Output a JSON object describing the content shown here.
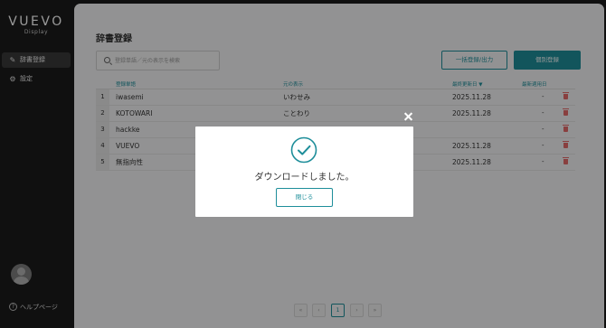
{
  "app": {
    "logo": "VUEVO",
    "logo_sub": "Display"
  },
  "sidebar": {
    "items": [
      {
        "label": "辞書登録",
        "icon": "edit-icon"
      },
      {
        "label": "設定",
        "icon": "gear-icon"
      }
    ],
    "help_label": "ヘルプページ"
  },
  "page": {
    "title": "辞書登録",
    "search_placeholder": "登録単語／元の表示を検索",
    "bulk_button": "一括登録/出力",
    "single_button": "個別登録"
  },
  "table": {
    "columns": [
      "登録単語",
      "元の表示",
      "最終更新日 ▼",
      "最新適用日"
    ],
    "rows": [
      {
        "no": "1",
        "word": "iwasemi",
        "original": "いわせみ",
        "updated": "2025.11.28",
        "applied": "-"
      },
      {
        "no": "2",
        "word": "KOTOWARI",
        "original": "ことわり",
        "updated": "2025.11.28",
        "applied": "-"
      },
      {
        "no": "3",
        "word": "hackke",
        "original": "",
        "updated": "",
        "applied": "-"
      },
      {
        "no": "4",
        "word": "VUEVO",
        "original": "",
        "updated": "2025.11.28",
        "applied": "-"
      },
      {
        "no": "5",
        "word": "無指向性",
        "original": "",
        "updated": "2025.11.28",
        "applied": "-"
      }
    ]
  },
  "pagination": {
    "first": "«",
    "prev": "‹",
    "current": "1",
    "next": "›",
    "last": "»"
  },
  "modal": {
    "message": "ダウンロードしました。",
    "close_button": "閉じる"
  },
  "colors": {
    "accent": "#1e8e9a",
    "sidebar_bg": "#1b1b1b",
    "delete": "#e46a6a"
  }
}
